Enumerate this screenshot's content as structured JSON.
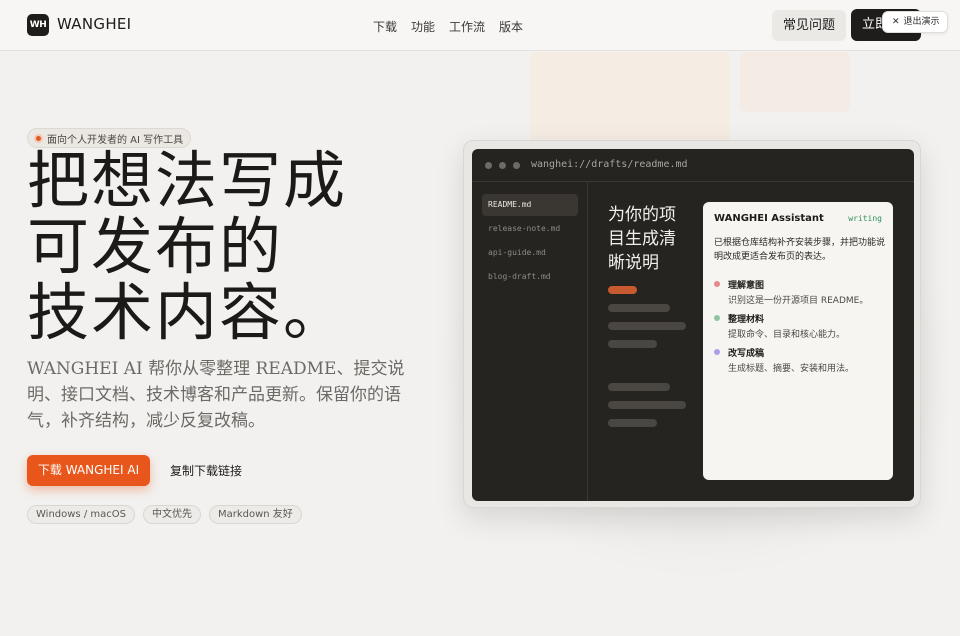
{
  "nav": {
    "logo_mark": "WH",
    "brand": "WANGHEI",
    "links": [
      "下载",
      "功能",
      "工作流",
      "版本"
    ],
    "faq_label": "常见问题",
    "cta_label": "立即试用",
    "exit_demo_label": "退出演示"
  },
  "hero": {
    "badge": "面向个人开发者的 AI 写作工具",
    "title_lines": [
      "把想法写成",
      "可发布的",
      "技术内容。"
    ],
    "description": "WANGHEI AI 帮你从零整理 README、提交说明、接口文档、技术博客和产品更新。保留你的语气，补齐结构，减少反复改稿。",
    "download_label": "下载 WANGHEI AI",
    "copy_link_label": "复制下载链接",
    "tags": [
      "Windows / macOS",
      "中文优先",
      "Markdown 友好"
    ]
  },
  "mockup": {
    "path": "wanghei://drafts/readme.md",
    "files": [
      "README.md",
      "release-note.md",
      "api-guide.md",
      "blog-draft.md"
    ],
    "doc_title": "为你的项目生成清晰说明",
    "assistant": {
      "title": "WANGHEI Assistant",
      "status": "writing",
      "intro": "已根据仓库结构补齐安装步骤，并把功能说明改成更适合发布页的表达。",
      "steps": [
        {
          "title": "理解意图",
          "desc": "识别这是一份开源项目 README。",
          "color": "#e58b8b"
        },
        {
          "title": "整理材料",
          "desc": "提取命令、目录和核心能力。",
          "color": "#8fc4a3"
        },
        {
          "title": "改写成稿",
          "desc": "生成标题、摘要、安装和用法。",
          "color": "#a7a2e6"
        }
      ]
    }
  }
}
